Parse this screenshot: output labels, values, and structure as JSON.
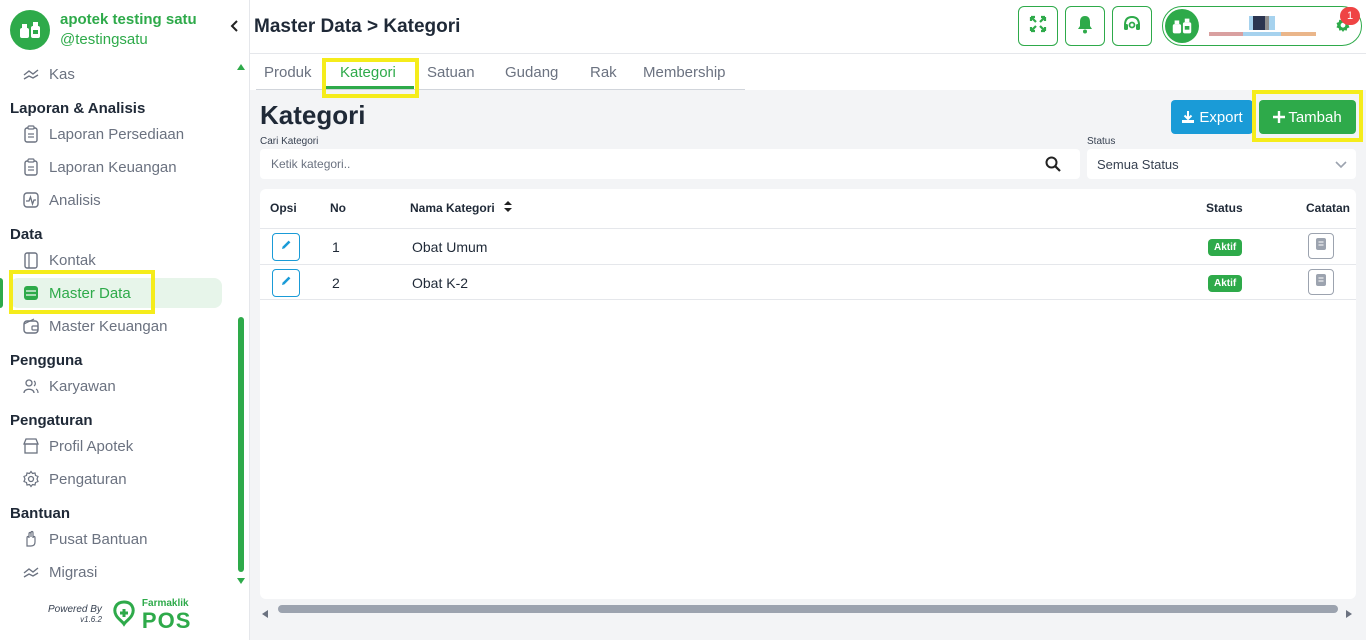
{
  "brand": {
    "name": "apotek testing satu",
    "username": "@testingsatu"
  },
  "sidebar": {
    "items": [
      {
        "label": "Kas"
      },
      {
        "label": "Laporan Persediaan"
      },
      {
        "label": "Laporan Keuangan"
      },
      {
        "label": "Analisis"
      },
      {
        "label": "Kontak"
      },
      {
        "label": "Master Data"
      },
      {
        "label": "Master Keuangan"
      },
      {
        "label": "Karyawan"
      },
      {
        "label": "Profil Apotek"
      },
      {
        "label": "Pengaturan"
      },
      {
        "label": "Pusat Bantuan"
      },
      {
        "label": "Migrasi"
      }
    ],
    "sections": [
      "Laporan & Analisis",
      "Data",
      "Pengguna",
      "Pengaturan",
      "Bantuan"
    ]
  },
  "footer": {
    "powered_by": "Powered By",
    "version": "v1.6.2",
    "logo_top": "Farmaklik",
    "logo_main": "POS"
  },
  "header": {
    "title": "Master Data > Kategori",
    "notification_count": "1"
  },
  "tabs": [
    "Produk",
    "Kategori",
    "Satuan",
    "Gudang",
    "Rak",
    "Membership"
  ],
  "content": {
    "title": "Kategori",
    "export_label": "Export",
    "add_label": "Tambah",
    "search_label": "Cari Kategori",
    "search_placeholder": "Ketik kategori..",
    "status_label": "Status",
    "status_value": "Semua Status"
  },
  "table": {
    "headers": {
      "opsi": "Opsi",
      "no": "No",
      "nama": "Nama Kategori",
      "status": "Status",
      "catatan": "Catatan"
    },
    "rows": [
      {
        "no": "1",
        "nama": "Obat Umum",
        "status": "Aktif"
      },
      {
        "no": "2",
        "nama": "Obat K-2",
        "status": "Aktif"
      }
    ]
  },
  "colors": {
    "accent": "#2eaa4a",
    "blue": "#1a9bd7",
    "highlight": "#f5ec1b"
  }
}
